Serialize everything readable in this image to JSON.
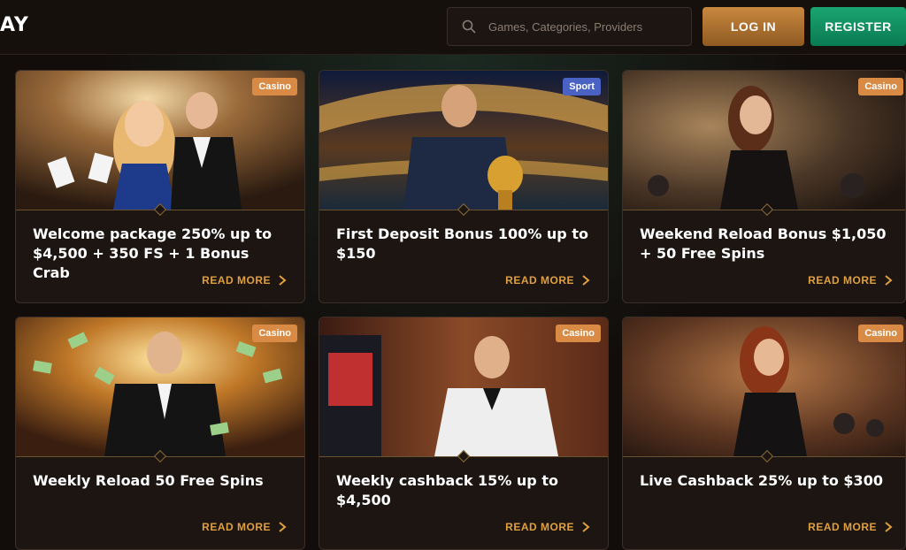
{
  "header": {
    "logo_text": "AY",
    "search_placeholder": "Games, Categories, Providers",
    "login_label": "LOG IN",
    "register_label": "REGISTER"
  },
  "colors": {
    "accent_gold": "#e0a040",
    "login_gradient": "#c8883f",
    "register_green": "#1aa572",
    "badge_casino": "#d98b45",
    "badge_sport": "#4a62c4"
  },
  "promotions": [
    {
      "category": "Casino",
      "title": "Welcome package 250% up to $4,500 + 350 FS + 1 Bonus Crab",
      "cta": "READ MORE"
    },
    {
      "category": "Sport",
      "title": "First Deposit Bonus 100% up to $150",
      "cta": "READ MORE"
    },
    {
      "category": "Casino",
      "title": "Weekend Reload Bonus $1,050 + 50 Free Spins",
      "cta": "READ MORE"
    },
    {
      "category": "Casino",
      "title": "Weekly Reload 50 Free Spins",
      "cta": "READ MORE"
    },
    {
      "category": "Casino",
      "title": "Weekly cashback 15% up to $4,500",
      "cta": "READ MORE"
    },
    {
      "category": "Casino",
      "title": "Live Cashback 25% up to $300",
      "cta": "READ MORE"
    }
  ]
}
